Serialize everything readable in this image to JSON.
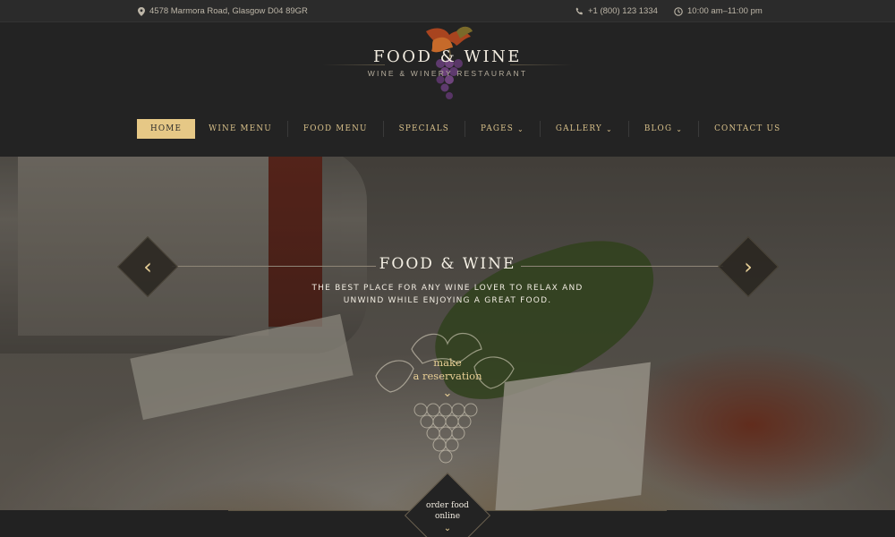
{
  "topbar": {
    "address": "4578 Marmora Road, Glasgow D04 89GR",
    "phone": "+1 (800) 123 1334",
    "hours": "10:00 am–11:00 pm",
    "address_icon": "map-pin-icon",
    "phone_icon": "phone-icon",
    "hours_icon": "clock-icon"
  },
  "logo": {
    "title": "FOOD & WINE",
    "subtitle": "WINE & WINERY RESTAURANT",
    "icon": "grapes-icon"
  },
  "nav": {
    "items": [
      {
        "label": "HOME",
        "active": true,
        "dropdown": false
      },
      {
        "label": "WINE MENU",
        "active": false,
        "dropdown": false
      },
      {
        "label": "FOOD MENU",
        "active": false,
        "dropdown": false
      },
      {
        "label": "SPECIALS",
        "active": false,
        "dropdown": false
      },
      {
        "label": "PAGES",
        "active": false,
        "dropdown": true
      },
      {
        "label": "GALLERY",
        "active": false,
        "dropdown": true
      },
      {
        "label": "BLOG",
        "active": false,
        "dropdown": true
      },
      {
        "label": "CONTACT US",
        "active": false,
        "dropdown": false
      }
    ]
  },
  "hero": {
    "title": "FOOD & WINE",
    "subtitle": "THE BEST PLACE FOR ANY WINE LOVER TO RELAX AND UNWIND WHILE ENJOYING A GREAT FOOD.",
    "prev_icon": "chevron-left-icon",
    "next_icon": "chevron-right-icon",
    "reservation_line1": "make",
    "reservation_line2": "a reservation",
    "reservation_icon": "chevron-down-icon"
  },
  "footer_cta": {
    "line1": "order food",
    "line2": "online",
    "icon": "chevron-down-icon"
  },
  "colors": {
    "accent": "#e6c886",
    "background": "#232323",
    "topbar": "#2b2b2b",
    "nav_text": "#d9c18a"
  }
}
